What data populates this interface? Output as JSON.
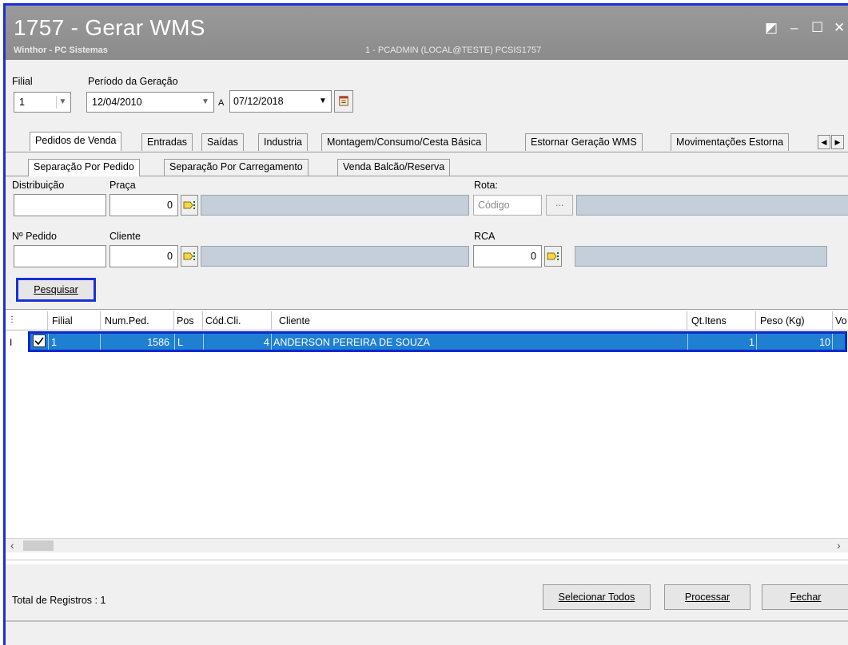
{
  "window": {
    "title": "1757 - Gerar WMS",
    "subtitle": "Winthor - PC Sistemas",
    "user_info": "1 - PCADMIN (LOCAL@TESTE)   PCSIS1757",
    "controls": [
      "◩",
      "–",
      "☐",
      "✕"
    ]
  },
  "filter": {
    "filial_label": "Filial",
    "filial_value": "1",
    "periodo_label": "Período da Geração",
    "date_start": "12/04/2010",
    "a_label": "A",
    "date_end": "07/12/2018"
  },
  "tabs_main": [
    "Pedidos de Venda",
    "Entradas",
    "Saídas",
    "Industria",
    "Montagem/Consumo/Cesta Básica",
    "Estornar Geração WMS",
    "Movimentações Estorna"
  ],
  "tabs_sub": [
    "Separação Por Pedido",
    "Separação Por Carregamento",
    "Venda Balcão/Reserva"
  ],
  "form": {
    "distribuicao_label": "Distribuição",
    "praca_label": "Praça",
    "praca_value": "0",
    "rota_label": "Rota:",
    "rota_placeholder": "Código",
    "rota_btn": "...",
    "pedido_label": "Nº Pedido",
    "cliente_label": "Cliente",
    "cliente_value": "0",
    "rca_label": "RCA",
    "rca_value": "0",
    "pesquisar": "Pesquisar"
  },
  "grid": {
    "columns": [
      "Filial",
      "Num.Ped.",
      "Pos",
      "Cód.Cli.",
      "Cliente",
      "Qt.Itens",
      "Peso (Kg)",
      "Vo"
    ],
    "rows": [
      {
        "filial": "1",
        "num_ped": "1586",
        "pos": "L",
        "cod_cli": "4",
        "cliente": "ANDERSON PEREIRA DE SOUZA",
        "qt_itens": "1",
        "peso": "10"
      }
    ]
  },
  "footer": {
    "total": "Total de Registros : 1",
    "selecionar": "Selecionar Todos",
    "processar": "Processar",
    "fechar": "Fechar"
  },
  "colors": {
    "accent_border": "#1c2fd8",
    "selection": "#1f7fd1",
    "titlebar": "#8f8f8f"
  }
}
